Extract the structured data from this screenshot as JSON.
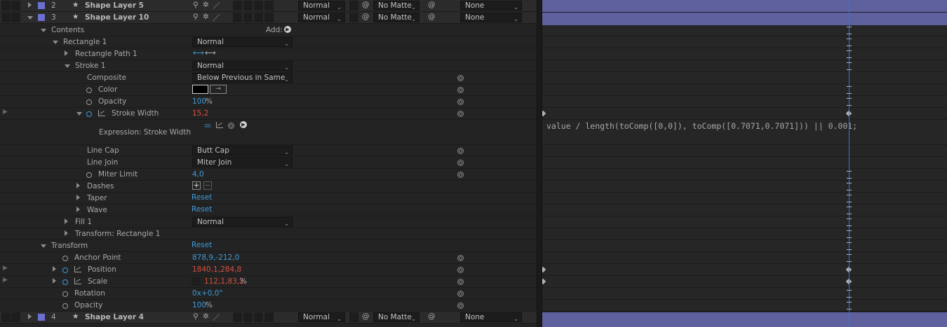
{
  "layers_top": [
    {
      "index": "2",
      "name": "Shape Layer 5",
      "mode": "Normal",
      "matte": "No Matte",
      "parent": "None"
    },
    {
      "index": "3",
      "name": "Shape Layer 10",
      "mode": "Normal",
      "matte": "No Matte",
      "parent": "None"
    }
  ],
  "contents": {
    "label": "Contents",
    "add_label": "Add:"
  },
  "rectangle": {
    "label": "Rectangle 1",
    "mode": "Normal"
  },
  "rect_path": {
    "label": "Rectangle Path 1"
  },
  "stroke": {
    "label": "Stroke 1",
    "mode": "Normal"
  },
  "composite": {
    "label": "Composite",
    "value": "Below Previous in Same"
  },
  "color": {
    "label": "Color"
  },
  "opacity1": {
    "label": "Opacity",
    "value": "100",
    "unit": "%"
  },
  "stroke_width": {
    "label": "Stroke Width",
    "value": "15,2"
  },
  "expression": {
    "label": "Expression: Stroke Width",
    "text": "value / length(toComp([0,0]), toComp([0.7071,0.7071])) || 0.001;"
  },
  "line_cap": {
    "label": "Line Cap",
    "value": "Butt Cap"
  },
  "line_join": {
    "label": "Line Join",
    "value": "Miter Join"
  },
  "miter_limit": {
    "label": "Miter Limit",
    "value": "4,0"
  },
  "dashes": {
    "label": "Dashes"
  },
  "taper": {
    "label": "Taper",
    "reset": "Reset"
  },
  "wave": {
    "label": "Wave",
    "reset": "Reset"
  },
  "fill": {
    "label": "Fill 1",
    "mode": "Normal"
  },
  "transform_rect": {
    "label": "Transform: Rectangle 1"
  },
  "transform": {
    "label": "Transform",
    "reset": "Reset"
  },
  "anchor": {
    "label": "Anchor Point",
    "value": "878,9,-212,0"
  },
  "position": {
    "label": "Position",
    "value": "1840,1,284,8"
  },
  "scale": {
    "label": "Scale",
    "value": "112,1,83,2",
    "unit": "%"
  },
  "rotation": {
    "label": "Rotation",
    "value": "0x+0,0°"
  },
  "opacity2": {
    "label": "Opacity",
    "value": "100",
    "unit": "%"
  },
  "layers_bottom": [
    {
      "index": "4",
      "name": "Shape Layer 4",
      "mode": "Normal",
      "matte": "No Matte",
      "parent": "None"
    }
  ],
  "colors": {
    "label_purple": "#6b6fd0",
    "timeline_bar": "#5f619f",
    "cti": "#3a78c7",
    "value_blue": "#3d9bd8",
    "value_red": "#d6503f"
  }
}
